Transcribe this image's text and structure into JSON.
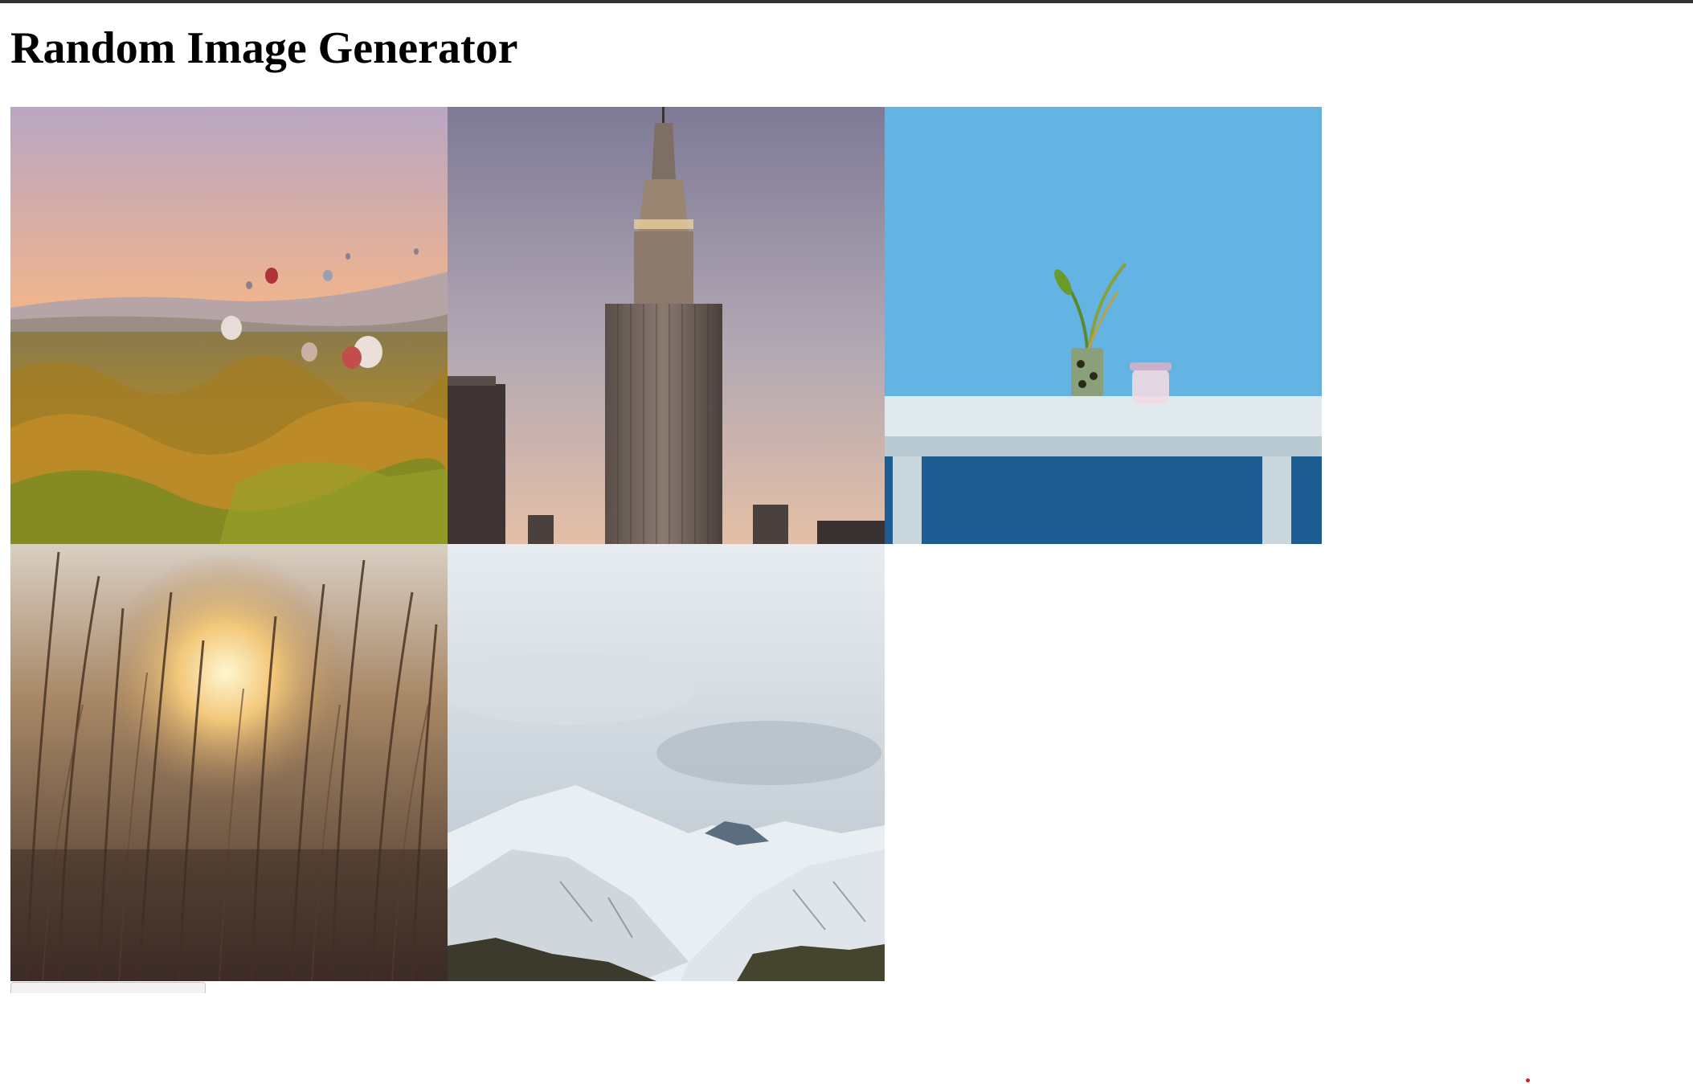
{
  "page": {
    "title": "Random Image Generator"
  },
  "images": [
    {
      "subject": "hot-air-balloons-valley"
    },
    {
      "subject": "skyscraper-dusk"
    },
    {
      "subject": "plant-on-blue-table"
    },
    {
      "subject": "sunset-through-reeds"
    },
    {
      "subject": "snowy-mountains"
    }
  ],
  "generate_button": {
    "label": ""
  },
  "colors": {
    "top_bar": "#333333",
    "cursor": "#d62020"
  }
}
